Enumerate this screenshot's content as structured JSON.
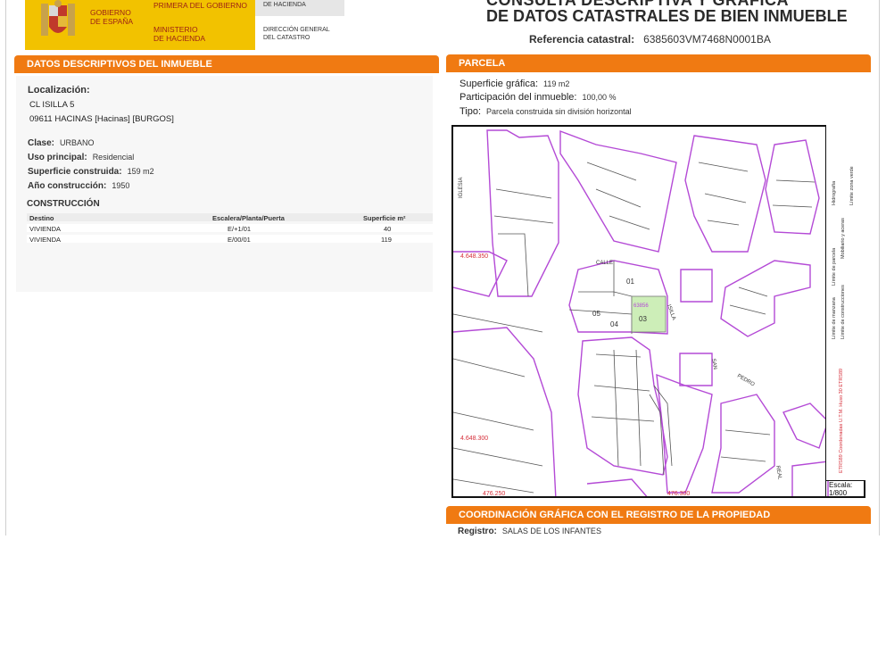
{
  "header": {
    "gov_line1": "GOBIERNO",
    "gov_line2": "DE ESPAÑA",
    "gov_primera": "PRIMERA DEL GOBIERNO",
    "ministerio_line1": "MINISTERIO",
    "ministerio_line2": "DE HACIENDA",
    "top_right_small": "DE HACIENDA",
    "dg_line1": "DIRECCIÓN GENERAL",
    "dg_line2": "DEL CATASTRO",
    "title_cut": "CONSULTA DESCRIPTIVA Y GRÁFICA",
    "title": "DE DATOS CATASTRALES DE BIEN INMUEBLE",
    "ref_label": "Referencia catastral:",
    "ref_value": "6385603VM7468N0001BA"
  },
  "left": {
    "section_title": "DATOS DESCRIPTIVOS DEL INMUEBLE",
    "localizacion_label": "Localización:",
    "address_line1": "CL ISILLA 5",
    "address_line2": "09611 HACINAS [Hacinas] [BURGOS]",
    "clase_label": "Clase:",
    "clase_value": "URBANO",
    "uso_label": "Uso principal:",
    "uso_value": "Residencial",
    "superficie_label": "Superficie construida:",
    "superficie_value": "159 m2",
    "anio_label": "Año construcción:",
    "anio_value": "1950",
    "construccion_title": "CONSTRUCCIÓN",
    "table": {
      "headers": [
        "Destino",
        "Escalera/Planta/Puerta",
        "Superficie m²"
      ],
      "rows": [
        [
          "VIVIENDA",
          "E/+1/01",
          "40"
        ],
        [
          "VIVIENDA",
          "E/00/01",
          "119"
        ]
      ]
    }
  },
  "right": {
    "section_title": "PARCELA",
    "sup_label": "Superficie gráfica:",
    "sup_value": "119 m2",
    "part_label": "Participación del inmueble:",
    "part_value": "100,00 %",
    "tipo_label": "Tipo:",
    "tipo_value": "Parcela construida sin división horizontal",
    "map": {
      "labels": {
        "coord_y1": "4.648.350",
        "coord_y2": "4.648.300",
        "coord_x1": "476.250",
        "coord_x2": "476.300",
        "parcel_01": "01",
        "parcel_03": "03",
        "parcel_04": "04",
        "parcel_05": "05",
        "calle": "CALLE",
        "isilla": "ISILLA",
        "iglesia": "IGLESIA",
        "san": "SAN",
        "pedro": "PEDRO",
        "real": "REAL",
        "highlight_code": "63856"
      },
      "legend": {
        "l1": "Límite de manzana",
        "l2": "Límite de parcela",
        "l3": "Límite de construcciones",
        "l4": "Mobiliario y aceras",
        "l5": "Límite zona verde",
        "l6": "Hidrografía",
        "crs": "ETRS89 Coordenadas U.T.M. Huso 30 ETRS89"
      },
      "scale_label": "Escala:",
      "scale_value": "1/800",
      "colors": {
        "manzana": "#b44ad6",
        "parcel_fill": "#cdeeb8",
        "coord": "#d6303b"
      }
    }
  },
  "bottom": {
    "section_title": "COORDINACIÓN GRÁFICA CON EL REGISTRO DE LA PROPIEDAD",
    "registro_label": "Registro:",
    "registro_value": "SALAS DE LOS INFANTES"
  },
  "colors": {
    "accent": "#f07a12",
    "gov_yellow": "#f2c200",
    "gov_red": "#9b1f16"
  }
}
